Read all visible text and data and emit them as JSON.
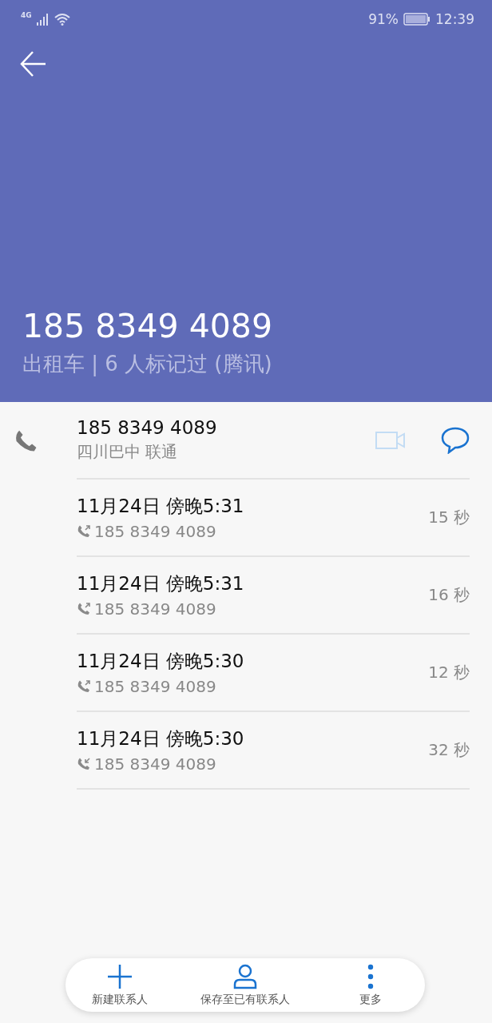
{
  "status_bar": {
    "network": "4G",
    "battery": "91%",
    "time": "12:39"
  },
  "header": {
    "number": "185 8349 4089",
    "subtitle": "出租车 | 6 人标记过 (腾讯)"
  },
  "contact": {
    "number": "185 8349 4089",
    "location": "四川巴中 联通",
    "video_disabled": true
  },
  "calls": [
    {
      "kind": "outgoing",
      "time": "11月24日 傍晚5:31",
      "number": "185 8349 4089",
      "duration": "15 秒"
    },
    {
      "kind": "outgoing",
      "time": "11月24日 傍晚5:31",
      "number": "185 8349 4089",
      "duration": "16 秒"
    },
    {
      "kind": "outgoing",
      "time": "11月24日 傍晚5:30",
      "number": "185 8349 4089",
      "duration": "12 秒"
    },
    {
      "kind": "incoming",
      "time": "11月24日 傍晚5:30",
      "number": "185 8349 4089",
      "duration": "32 秒"
    }
  ],
  "actions": [
    {
      "kind": "add",
      "label": "新建联系人"
    },
    {
      "kind": "person",
      "label": "保存至已有联系人"
    },
    {
      "kind": "more",
      "label": "更多"
    }
  ]
}
